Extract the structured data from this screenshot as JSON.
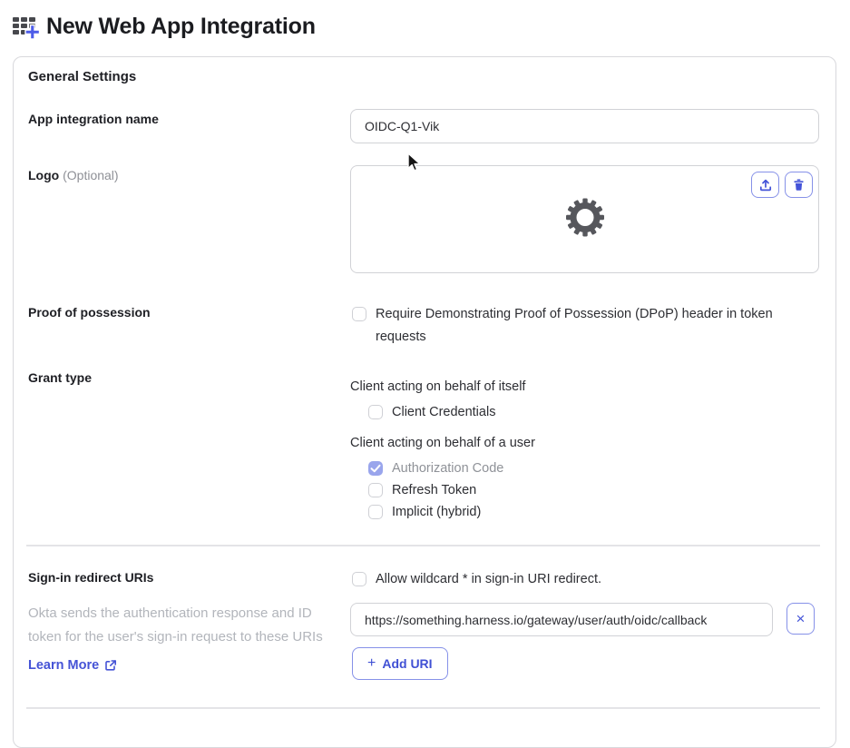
{
  "header": {
    "title": "New Web App Integration",
    "icon": "app-grid-plus-icon"
  },
  "card": {
    "section_title": "General Settings",
    "app_name": {
      "label": "App integration name",
      "value": "OIDC-Q1-Vik"
    },
    "logo": {
      "label": "Logo",
      "optional_suffix": "(Optional)",
      "upload_icon": "upload-icon",
      "delete_icon": "trash-icon",
      "placeholder_icon": "gear-icon"
    },
    "proof": {
      "label": "Proof of possession",
      "checkbox_label": "Require Demonstrating Proof of Possession (DPoP) header in token requests",
      "checked": false
    },
    "grant": {
      "label": "Grant type",
      "groups": [
        {
          "heading": "Client acting on behalf of itself",
          "options": [
            {
              "label": "Client Credentials",
              "checked": false,
              "disabled": false
            }
          ]
        },
        {
          "heading": "Client acting on behalf of a user",
          "options": [
            {
              "label": "Authorization Code",
              "checked": true,
              "disabled": true
            },
            {
              "label": "Refresh Token",
              "checked": false,
              "disabled": false
            },
            {
              "label": "Implicit (hybrid)",
              "checked": false,
              "disabled": false
            }
          ]
        }
      ]
    },
    "redirect": {
      "label": "Sign-in redirect URIs",
      "wildcard_label": "Allow wildcard * in sign-in URI redirect.",
      "wildcard_checked": false,
      "help_text": "Okta sends the authentication response and ID token for the user's sign-in request to these URIs",
      "learn_more_label": "Learn More",
      "learn_more_icon": "external-link-icon",
      "uri_value": "https://something.harness.io/gateway/user/auth/oidc/callback",
      "remove_uri_label": "×",
      "add_uri_label": "Add URI",
      "add_uri_plus": "+"
    }
  },
  "colors": {
    "accent_blue": "#4353d8",
    "button_border_blue": "#8691e8",
    "checked_checkbox_fill": "#99a5ec",
    "divider": "#e4e4e7",
    "muted_text": "#8e9096",
    "help_text": "#b2b5bb"
  }
}
